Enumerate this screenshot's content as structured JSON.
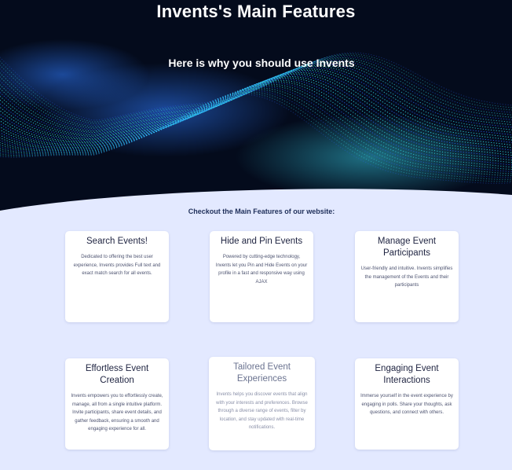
{
  "hero": {
    "title": "Invents's Main Features",
    "subtitle": "Here is why you should use Invents"
  },
  "section": {
    "heading": "Checkout the Main Features of our website:"
  },
  "features": [
    {
      "title": "Search Events!",
      "description": "Dedicated to offering the best user experience, Invents provides Full text and exact match search for all events."
    },
    {
      "title": "Hide and Pin Events",
      "description": "Powered by cutting-edge technology, Invents let you Pin and Hide Events on your profile in a fast and responsive way using AJAX"
    },
    {
      "title": "Manage Event Participants",
      "description": "User-friendly and intuitive. Invents simplifies the management of the Events and their participants"
    },
    {
      "title": "Effortless Event Creation",
      "description": "Invents empowers you to effortlessly create, manage, all from a single intuitive platform. Invite participants, share event details, and gather feedback, ensuring a smooth and engaging experience for all."
    },
    {
      "title": "Tailored Event Experiences",
      "description": "Invents helps you discover events that align with your interests and preferences. Browse through a diverse range of events, filter by location, and stay updated with real-time notifications."
    },
    {
      "title": "Engaging Event Interactions",
      "description": "Immerse yourself in the event experience by engaging in polls. Share your thoughts, ask questions, and connect with others."
    }
  ],
  "colors": {
    "hero_background": "#040b1c",
    "page_background": "#e3e9ff",
    "wave_cyan": "#35e6ee",
    "wave_blue": "#2a66ff"
  }
}
